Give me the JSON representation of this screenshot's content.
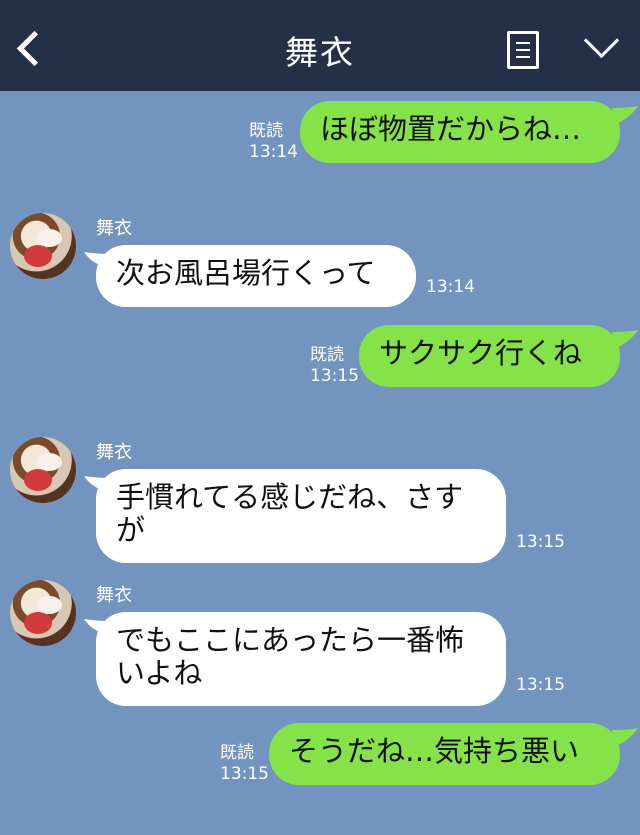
{
  "header": {
    "title": "舞衣"
  },
  "messages": [
    {
      "side": "mine",
      "text": "ほぼ物置だからね…",
      "read": "既読",
      "time": "13:14"
    },
    {
      "side": "theirs",
      "sender": "舞衣",
      "text": "次お風呂場行くって",
      "time": "13:14"
    },
    {
      "side": "mine",
      "text": "サクサク行くね",
      "read": "既読",
      "time": "13:15"
    },
    {
      "side": "theirs",
      "sender": "舞衣",
      "line1": "手慣れてる感じだね、さす",
      "line2": "が",
      "time": "13:15"
    },
    {
      "side": "theirs",
      "sender": "舞衣",
      "line1": "でもここにあったら一番怖",
      "line2": "いよね",
      "time": "13:15"
    },
    {
      "side": "mine",
      "text": "そうだね…気持ち悪い",
      "read": "既読",
      "time": "13:15"
    }
  ],
  "colors": {
    "background": "#7494c0",
    "header": "#243048",
    "mine_bubble": "#85e249",
    "theirs_bubble": "#ffffff"
  }
}
